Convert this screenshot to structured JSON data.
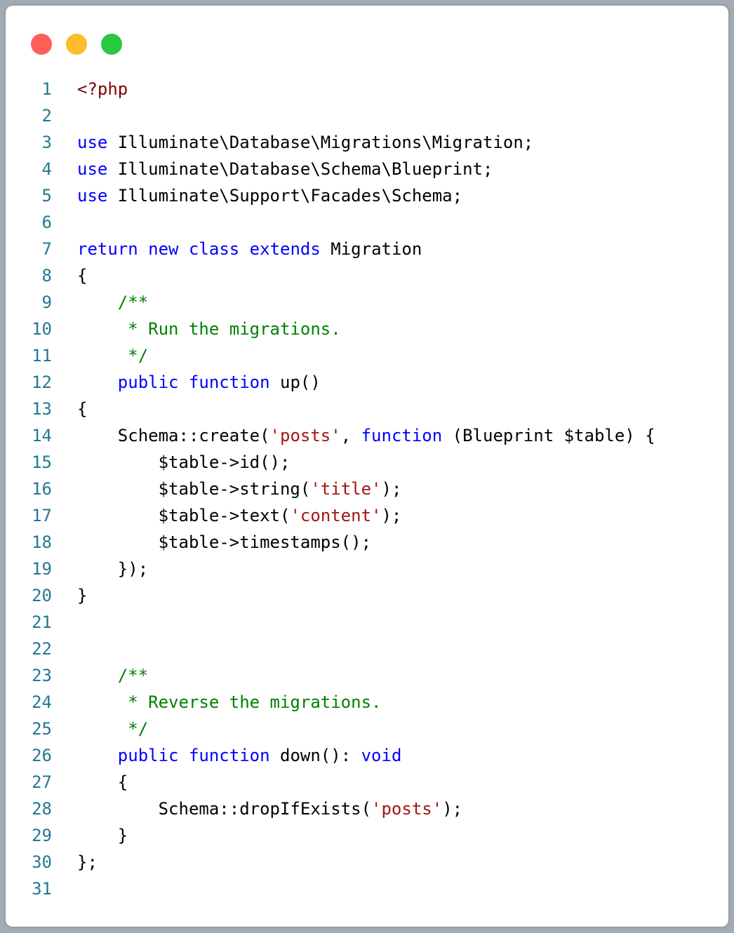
{
  "window": {
    "buttons": [
      "close",
      "minimize",
      "maximize"
    ],
    "colors": {
      "close": "#ff5f57",
      "minimize": "#febc2e",
      "maximize": "#28c840",
      "keyword": "#0000ff",
      "comment": "#008000",
      "string": "#a31515",
      "line_number": "#237893",
      "php_tag": "#800000"
    }
  },
  "code": {
    "lines": [
      {
        "n": "1",
        "tokens": [
          {
            "t": "<?php",
            "c": "ph"
          }
        ]
      },
      {
        "n": "2",
        "tokens": []
      },
      {
        "n": "3",
        "tokens": [
          {
            "t": "use",
            "c": "kw"
          },
          {
            "t": " Illuminate\\Database\\Migrations\\Migration;",
            "c": ""
          }
        ]
      },
      {
        "n": "4",
        "tokens": [
          {
            "t": "use",
            "c": "kw"
          },
          {
            "t": " Illuminate\\Database\\Schema\\Blueprint;",
            "c": ""
          }
        ]
      },
      {
        "n": "5",
        "tokens": [
          {
            "t": "use",
            "c": "kw"
          },
          {
            "t": " Illuminate\\Support\\Facades\\Schema;",
            "c": ""
          }
        ]
      },
      {
        "n": "6",
        "tokens": []
      },
      {
        "n": "7",
        "tokens": [
          {
            "t": "return",
            "c": "kw"
          },
          {
            "t": " ",
            "c": ""
          },
          {
            "t": "new",
            "c": "kw"
          },
          {
            "t": " ",
            "c": ""
          },
          {
            "t": "class",
            "c": "kw"
          },
          {
            "t": " ",
            "c": ""
          },
          {
            "t": "extends",
            "c": "kw"
          },
          {
            "t": " Migration",
            "c": ""
          }
        ]
      },
      {
        "n": "8",
        "tokens": [
          {
            "t": "{",
            "c": ""
          }
        ]
      },
      {
        "n": "9",
        "tokens": [
          {
            "t": "    /**",
            "c": "cm"
          }
        ]
      },
      {
        "n": "10",
        "tokens": [
          {
            "t": "     * Run the migrations.",
            "c": "cm"
          }
        ]
      },
      {
        "n": "11",
        "tokens": [
          {
            "t": "     */",
            "c": "cm"
          }
        ]
      },
      {
        "n": "12",
        "tokens": [
          {
            "t": "    ",
            "c": ""
          },
          {
            "t": "public",
            "c": "kw"
          },
          {
            "t": " ",
            "c": ""
          },
          {
            "t": "function",
            "c": "kw"
          },
          {
            "t": " up()",
            "c": ""
          }
        ]
      },
      {
        "n": "13",
        "tokens": [
          {
            "t": "{",
            "c": ""
          }
        ]
      },
      {
        "n": "14",
        "tokens": [
          {
            "t": "    Schema::create(",
            "c": ""
          },
          {
            "t": "'posts'",
            "c": "st"
          },
          {
            "t": ", ",
            "c": ""
          },
          {
            "t": "function",
            "c": "kw"
          },
          {
            "t": " (Blueprint $table) {",
            "c": ""
          }
        ]
      },
      {
        "n": "15",
        "tokens": [
          {
            "t": "        $table->id();",
            "c": ""
          }
        ]
      },
      {
        "n": "16",
        "tokens": [
          {
            "t": "        $table->string(",
            "c": ""
          },
          {
            "t": "'title'",
            "c": "st"
          },
          {
            "t": ");",
            "c": ""
          }
        ]
      },
      {
        "n": "17",
        "tokens": [
          {
            "t": "        $table->text(",
            "c": ""
          },
          {
            "t": "'content'",
            "c": "st"
          },
          {
            "t": ");",
            "c": ""
          }
        ]
      },
      {
        "n": "18",
        "tokens": [
          {
            "t": "        $table->timestamps();",
            "c": ""
          }
        ]
      },
      {
        "n": "19",
        "tokens": [
          {
            "t": "    });",
            "c": ""
          }
        ]
      },
      {
        "n": "20",
        "tokens": [
          {
            "t": "}",
            "c": ""
          }
        ]
      },
      {
        "n": "21",
        "tokens": []
      },
      {
        "n": "22",
        "tokens": []
      },
      {
        "n": "23",
        "tokens": [
          {
            "t": "    /**",
            "c": "cm"
          }
        ]
      },
      {
        "n": "24",
        "tokens": [
          {
            "t": "     * Reverse the migrations.",
            "c": "cm"
          }
        ]
      },
      {
        "n": "25",
        "tokens": [
          {
            "t": "     */",
            "c": "cm"
          }
        ]
      },
      {
        "n": "26",
        "tokens": [
          {
            "t": "    ",
            "c": ""
          },
          {
            "t": "public",
            "c": "kw"
          },
          {
            "t": " ",
            "c": ""
          },
          {
            "t": "function",
            "c": "kw"
          },
          {
            "t": " down(): ",
            "c": ""
          },
          {
            "t": "void",
            "c": "kw"
          }
        ]
      },
      {
        "n": "27",
        "tokens": [
          {
            "t": "    {",
            "c": ""
          }
        ]
      },
      {
        "n": "28",
        "tokens": [
          {
            "t": "        Schema::dropIfExists(",
            "c": ""
          },
          {
            "t": "'posts'",
            "c": "st"
          },
          {
            "t": ");",
            "c": ""
          }
        ]
      },
      {
        "n": "29",
        "tokens": [
          {
            "t": "    }",
            "c": ""
          }
        ]
      },
      {
        "n": "30",
        "tokens": [
          {
            "t": "};",
            "c": ""
          }
        ]
      },
      {
        "n": "31",
        "tokens": []
      }
    ]
  }
}
